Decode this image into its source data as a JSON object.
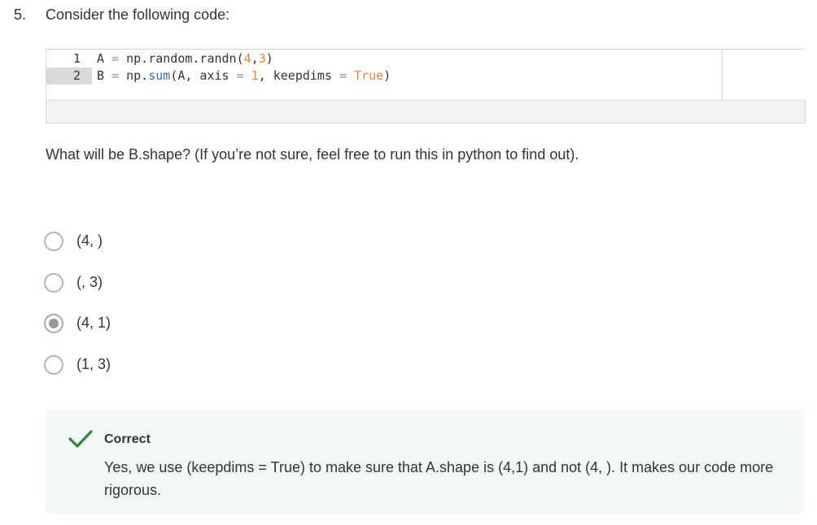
{
  "question": {
    "number": "5.",
    "prompt": "Consider the following code:",
    "text": "What will be B.shape? (If you’re not sure, feel free to run this in python to find out)."
  },
  "code": {
    "line_numbers": [
      "1",
      "2"
    ],
    "active_line": 2,
    "lines": [
      [
        {
          "t": "A ",
          "c": ""
        },
        {
          "t": "=",
          "c": "op"
        },
        {
          "t": " np.random.randn(",
          "c": ""
        },
        {
          "t": "4",
          "c": "num"
        },
        {
          "t": ",",
          "c": ""
        },
        {
          "t": "3",
          "c": "num"
        },
        {
          "t": ")",
          "c": ""
        }
      ],
      [
        {
          "t": "B ",
          "c": ""
        },
        {
          "t": "=",
          "c": "op"
        },
        {
          "t": " np.",
          "c": ""
        },
        {
          "t": "sum",
          "c": "fn"
        },
        {
          "t": "(A, axis ",
          "c": ""
        },
        {
          "t": "=",
          "c": "op"
        },
        {
          "t": " ",
          "c": ""
        },
        {
          "t": "1",
          "c": "num"
        },
        {
          "t": ", keepdims ",
          "c": ""
        },
        {
          "t": "=",
          "c": "op"
        },
        {
          "t": " ",
          "c": ""
        },
        {
          "t": "True",
          "c": "kw"
        },
        {
          "t": ")",
          "c": ""
        }
      ]
    ],
    "colors": {
      "number": "#e8892b",
      "keyword": "#e8892b",
      "function": "#2f6fb7",
      "operator": "#888888"
    }
  },
  "options": [
    {
      "label": "(4, )",
      "checked": false
    },
    {
      "label": "(, 3)",
      "checked": false
    },
    {
      "label": "(4, 1)",
      "checked": true
    },
    {
      "label": "(1, 3)",
      "checked": false
    }
  ],
  "feedback": {
    "icon": "checkmark-icon",
    "status": "Correct",
    "text": "Yes, we use (keepdims = True) to make sure that A.shape is (4,1) and not (4, ). It makes our code more rigorous.",
    "accent_color": "#2e8540",
    "background": "#f3f8f5"
  }
}
